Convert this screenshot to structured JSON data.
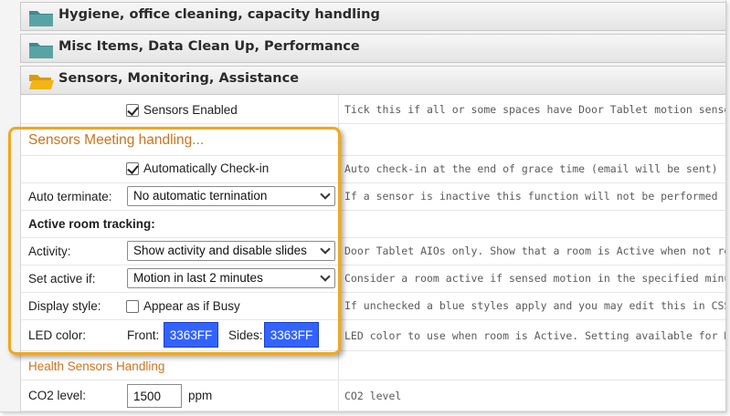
{
  "sections": [
    {
      "title": "Hygiene, office cleaning, capacity handling",
      "state": "closed",
      "folder_color": "#3f8a8c"
    },
    {
      "title": "Misc Items, Data Clean Up, Performance",
      "state": "closed",
      "folder_color": "#3f8a8c"
    },
    {
      "title": "Sensors, Monitoring, Assistance",
      "state": "open",
      "folder_color": "#f2b418"
    }
  ],
  "sensors_enabled": {
    "label": "Sensors Enabled",
    "checked": true,
    "desc": "Tick this if all or some spaces have Door Tablet motion senso"
  },
  "meeting_handling": {
    "heading": "Sensors Meeting handling...",
    "auto_checkin": {
      "label": "Automatically Check-in",
      "checked": true,
      "desc": "Auto check-in at the end of grace time (email will be sent)"
    },
    "auto_terminate": {
      "label": "Auto terminate:",
      "value": "No automatic ternination",
      "desc": "If a sensor is inactive this function will not be performed"
    },
    "active_tracking_heading": "Active room tracking:",
    "activity": {
      "label": "Activity:",
      "value": "Show activity and disable slides",
      "desc": "Door Tablet AIOs only. Show that a room is Active when not re"
    },
    "set_active": {
      "label": "Set active if:",
      "value": "Motion in last 2 minutes",
      "desc": "Consider a room active if sensed motion in the specified minu"
    },
    "display_style": {
      "label": "Display style:",
      "option_label": "Appear as if Busy",
      "checked": false,
      "desc": "If unchecked a blue styles apply and you may edit this in CSS"
    },
    "led_color": {
      "label": "LED color:",
      "front_label": "Front:",
      "front_value": "3363FF",
      "sides_label": "Sides:",
      "sides_value": "3363FF",
      "desc": "LED color to use when room is Active. Setting available for D"
    }
  },
  "health": {
    "heading": "Health Sensors Handling",
    "co2": {
      "label": "CO2 level:",
      "value": "1500",
      "unit": "ppm",
      "desc": "CO2 level"
    }
  },
  "colors": {
    "accent_orange": "#c9741e",
    "highlight_border": "#f0a81e",
    "led_blue": "#3363FF"
  }
}
